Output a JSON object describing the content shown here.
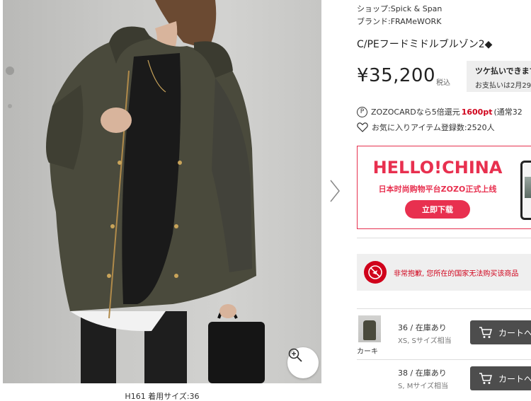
{
  "gallery": {
    "caption": "H161 着用サイズ:36",
    "zoom_icon": "zoom-in-icon",
    "next_icon": "chevron-right-icon"
  },
  "product": {
    "shop_line": "ショップ:Spick & Span",
    "brand_line": "ブランド:FRAMeWORK",
    "title": "C/PEフードミドルブルゾン2◆",
    "price": "¥35,200",
    "tax_label": "税込",
    "pay_later": {
      "title": "ツケ払いできます",
      "subtitle": "お支払いは2月29"
    },
    "points": {
      "icon_text": "P",
      "prefix": "ZOZOCARDなら5倍還元",
      "value": "1600pt",
      "suffix": "(通常32"
    },
    "favorite": {
      "label": "お気に入りアイテム登録数:2520人",
      "icon": "heart-icon"
    }
  },
  "banner": {
    "title": "HELLO!CHINA",
    "subtitle": "日本时尚购物平台ZOZO正式上线",
    "button": "立即下载"
  },
  "notice": {
    "icon": "no-shipping-icon",
    "text": "非常抱歉, 您所在的国家无法购买该商品"
  },
  "skus": [
    {
      "color": "カーキ",
      "size": "36 / 在庫あり",
      "hint": "XS, Sサイズ相当",
      "cart_label": "カートへ"
    },
    {
      "color": "",
      "size": "38 / 在庫あり",
      "hint": "S, Mサイズ相当",
      "cart_label": "カートへ"
    }
  ],
  "colors": {
    "accent_red": "#e8304f",
    "point_red": "#d0021b",
    "cart_button": "#4d4d4d",
    "jacket_khaki": "#4a4a3c"
  }
}
